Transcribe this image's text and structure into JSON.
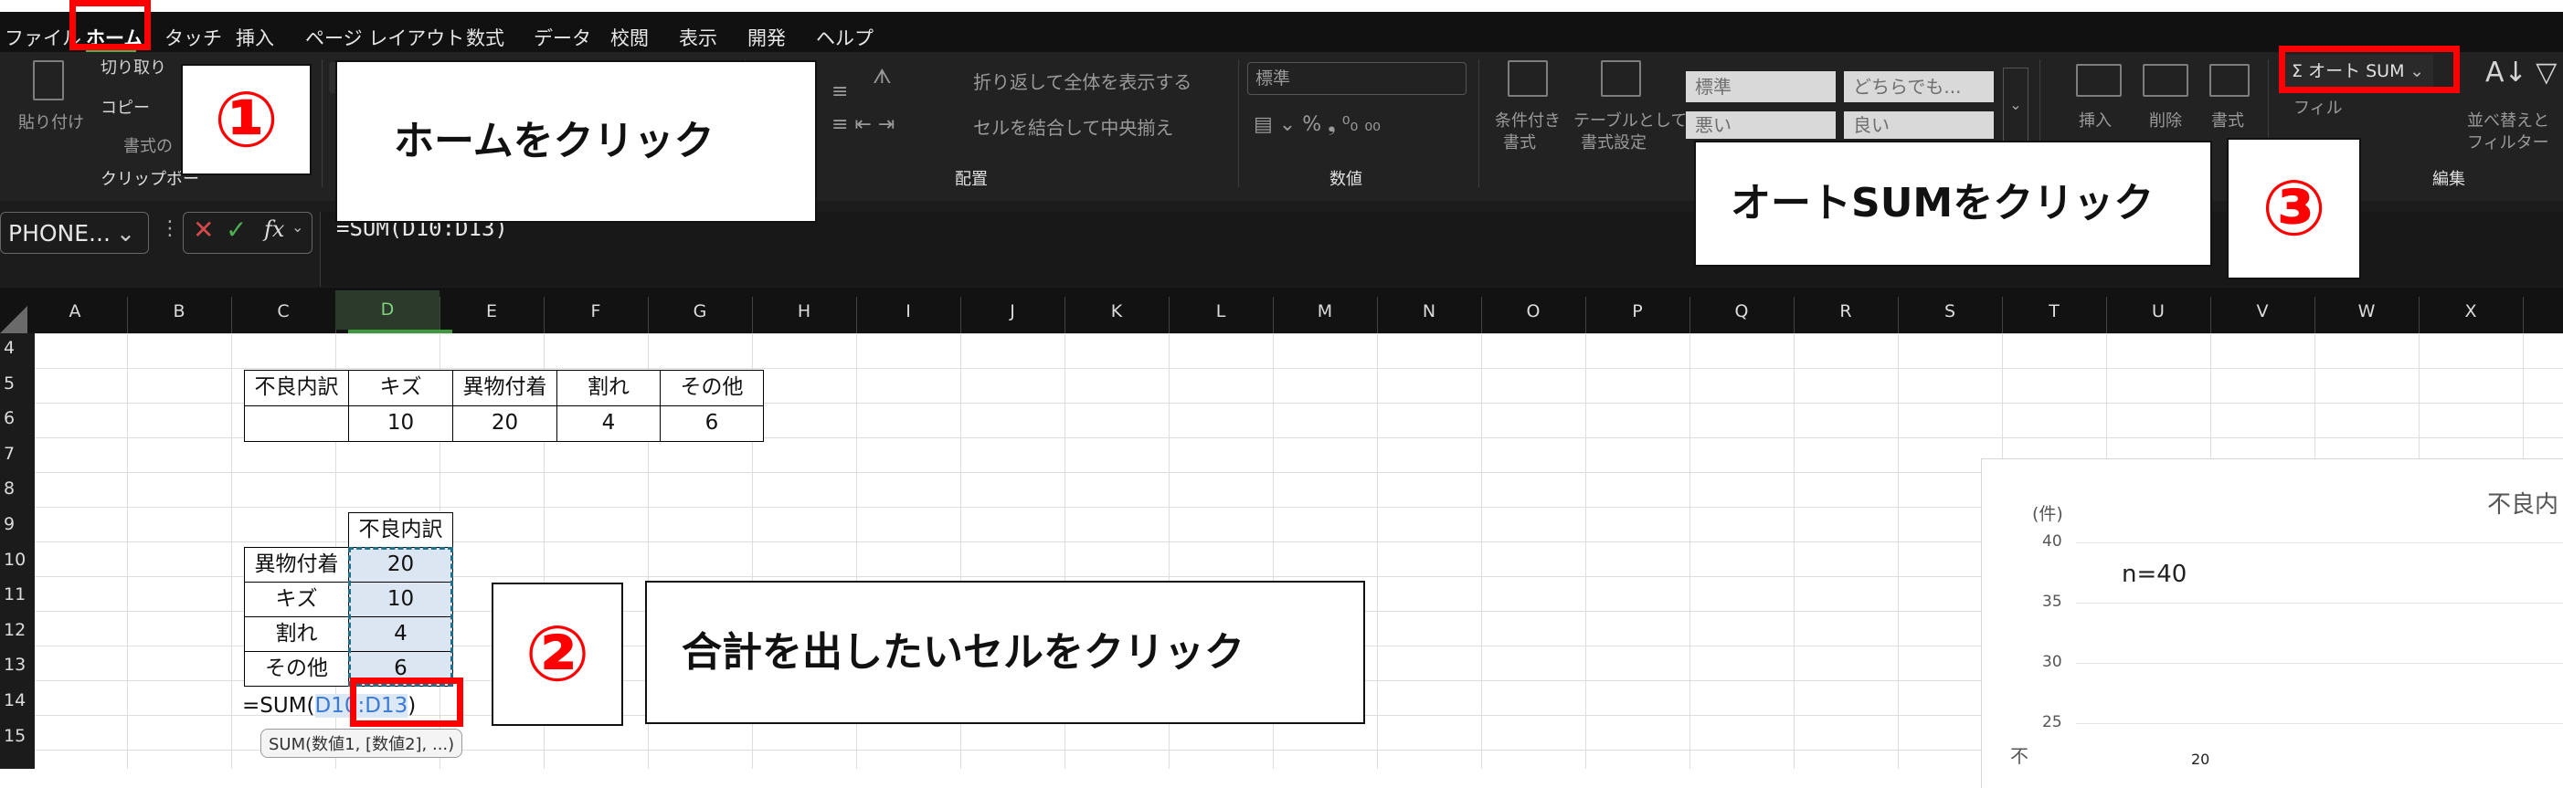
{
  "menu": {
    "tabs": [
      "ファイル",
      "ホーム",
      "タッチ",
      "挿入",
      "ページ レイアウト",
      "数式",
      "データ",
      "校閲",
      "表示",
      "開発",
      "ヘルプ"
    ]
  },
  "ribbon": {
    "clipboard": {
      "paste": "貼り付け",
      "cut": "切り取り",
      "copy": "コピー",
      "format": "書式の",
      "group_label": "クリップボー"
    },
    "alignment": {
      "wrap": "折り返して全体を表示する",
      "merge": "セルを結合して中央揃え",
      "group_label": "配置"
    },
    "number": {
      "format_value": "標準",
      "group_label": "数値"
    },
    "styles": {
      "cond_format": [
        "条件付き",
        "書式"
      ],
      "table_format": [
        "テーブルとして",
        "書式設定"
      ],
      "boxes": [
        "標準",
        "どちらでも...",
        "悪い",
        "良い"
      ]
    },
    "cells": {
      "insert": "挿入",
      "delete": "削除",
      "format": "書式"
    },
    "editing": {
      "autosum": "オート SUM",
      "fill": "フィル",
      "sort_filter": [
        "並べ替えと",
        "フィルター"
      ],
      "group_label": "編集"
    }
  },
  "formula_bar": {
    "name_box": "PHONE...",
    "fx": "fx",
    "formula": "=SUM(D10:D13)"
  },
  "columns": [
    "A",
    "B",
    "C",
    "D",
    "E",
    "F",
    "G",
    "H",
    "I",
    "J",
    "K",
    "L",
    "M",
    "N",
    "O",
    "P",
    "Q",
    "R",
    "S",
    "T",
    "U",
    "V",
    "W",
    "X"
  ],
  "rows": [
    "4",
    "5",
    "6",
    "7",
    "8",
    "9",
    "10",
    "11",
    "12",
    "13",
    "14",
    "15"
  ],
  "table1": {
    "headers": [
      "不良内訳",
      "キズ",
      "異物付着",
      "割れ",
      "その他"
    ],
    "values": [
      "",
      "10",
      "20",
      "4",
      "6"
    ]
  },
  "table2": {
    "header": "不良内訳",
    "rows": [
      {
        "label": "異物付着",
        "value": "20"
      },
      {
        "label": "キズ",
        "value": "10"
      },
      {
        "label": "割れ",
        "value": "4"
      },
      {
        "label": "その他",
        "value": "6"
      }
    ],
    "sum_cell_prefix": "=SUM(",
    "sum_cell_ref": "D10:D13",
    "sum_cell_suffix": ")",
    "tooltip": "SUM(数値1, [数値2], ...)"
  },
  "chart": {
    "unit": "(件)",
    "title": "不良内",
    "n_label": "n=40",
    "ticks": [
      "40",
      "35",
      "30",
      "25"
    ],
    "bar_label": "20",
    "ylabel_fragment": "不"
  },
  "callouts": {
    "step1": {
      "num": "①",
      "text": "ホームをクリック"
    },
    "step2": {
      "num": "②",
      "text": "合計を出したいセルをクリック"
    },
    "step3": {
      "num": "③",
      "text": "オートSUMをクリック"
    }
  },
  "colors": {
    "highlight": "#ff0000",
    "ribbon": "#222222",
    "selection": "#dce6f2"
  }
}
